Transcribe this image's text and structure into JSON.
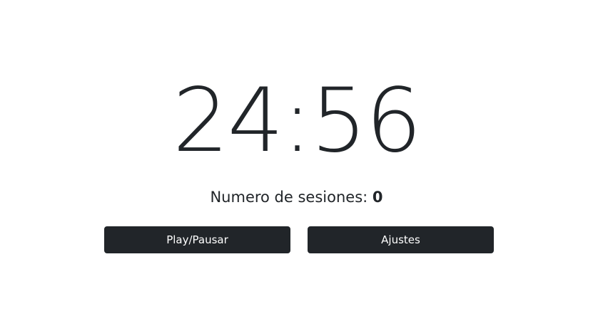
{
  "timer": {
    "display": "24:56"
  },
  "sessions": {
    "label": "Numero de sesiones:",
    "count": "0"
  },
  "controls": {
    "play_pause_label": "Play/Pausar",
    "settings_label": "Ajustes"
  },
  "colors": {
    "text": "#212529",
    "button_bg": "#212529",
    "button_text": "#ffffff",
    "background": "#ffffff"
  }
}
